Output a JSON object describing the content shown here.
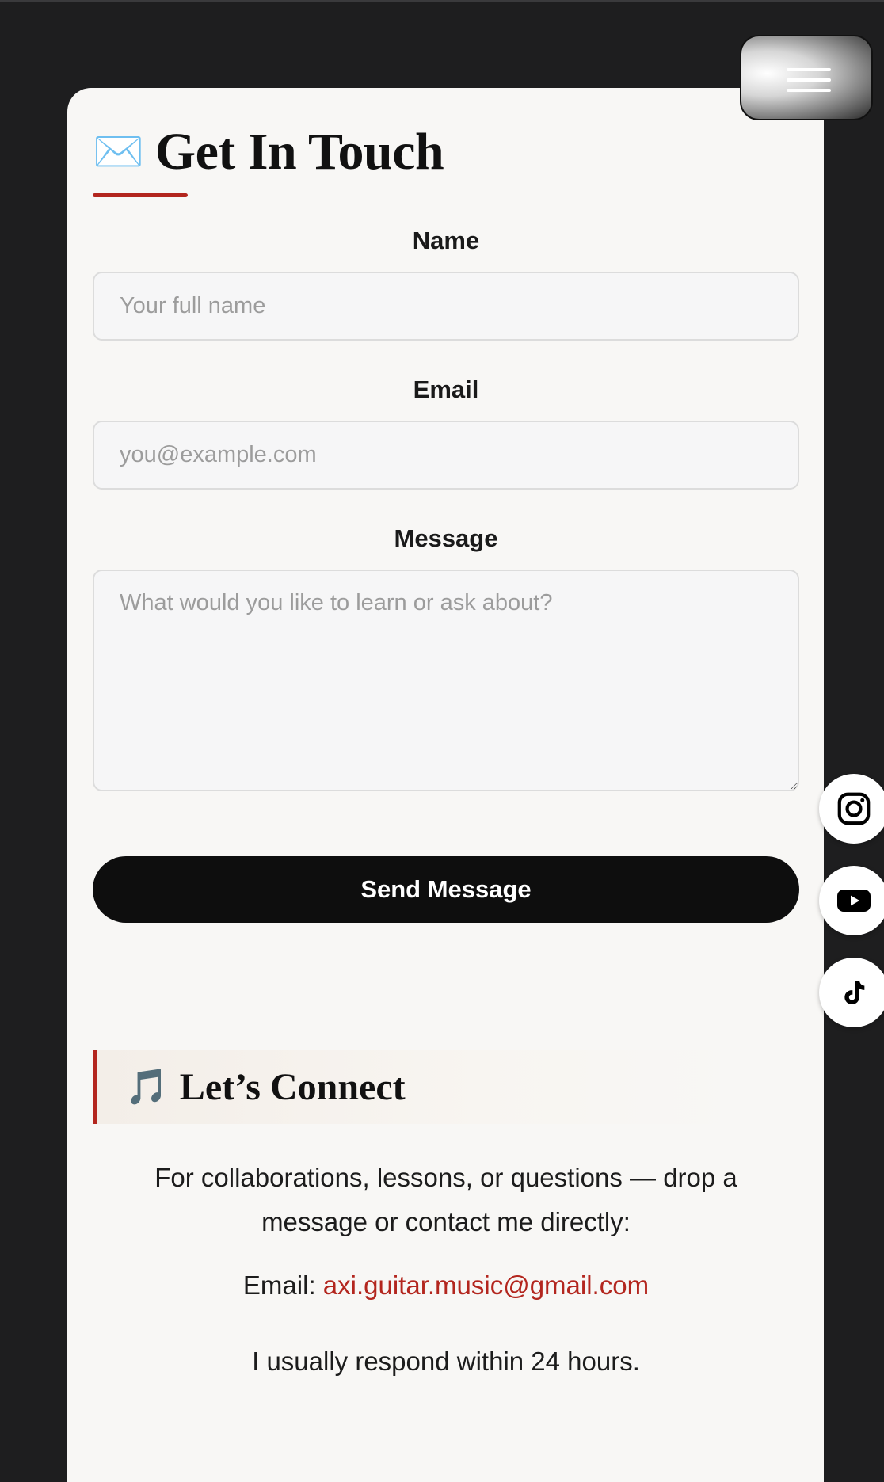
{
  "header": {
    "menu_icon": "hamburger-menu-icon"
  },
  "contact_form": {
    "title_emoji": "✉️",
    "title": "Get In Touch",
    "name_label": "Name",
    "name_placeholder": "Your full name",
    "name_value": "",
    "email_label": "Email",
    "email_placeholder": "you@example.com",
    "email_value": "",
    "message_label": "Message",
    "message_placeholder": "What would you like to learn or ask about?",
    "message_value": "",
    "submit_label": "Send Message"
  },
  "connect": {
    "emoji": "🎵",
    "title": "Let’s Connect",
    "description": "For collaborations, lessons, or questions — drop a message or contact me directly:",
    "email_prefix": "Email: ",
    "email_address": "axi.guitar.music@gmail.com",
    "response_note": "I usually respond within 24 hours."
  },
  "social_links": [
    {
      "icon": "instagram-icon"
    },
    {
      "icon": "youtube-icon"
    },
    {
      "icon": "tiktok-icon"
    }
  ],
  "colors": {
    "page_background": "#1e1e1f",
    "card_background": "#f8f7f5",
    "accent": "#b3261e",
    "button": "#0e0e0e"
  }
}
